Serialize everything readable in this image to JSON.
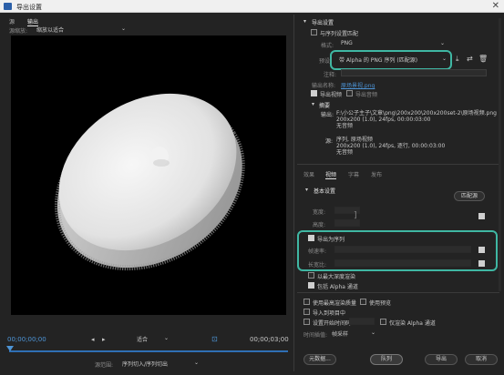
{
  "window": {
    "title": "导出设置",
    "close_glyph": "✕"
  },
  "left": {
    "tabs": [
      "源",
      "输出"
    ],
    "source_scaling_label": "源缩放:",
    "source_scaling_value": "缩放以适合",
    "timecode_start": "00;00;00;00",
    "timecode_end": "00;00;03;00",
    "fit_label": "适合",
    "source_range_label": "源范围:",
    "source_range_value": "序列切入/序列切出"
  },
  "export": {
    "section_title": "导出设置",
    "match_sequence": "与序列设置匹配",
    "format_label": "格式:",
    "format_value": "PNG",
    "preset_label": "预设:",
    "preset_value": "带 Alpha 的 PNG 序列 (匹配源)",
    "comments_label": "注释:",
    "output_name_label": "输出名称:",
    "output_name_value": "原场景视.png",
    "export_video": "导出视频",
    "export_audio": "导出音频",
    "summary_title": "摘要",
    "summary_output_label": "输出:",
    "summary_output_lines": [
      "F:\\小公子主子\\文章\\png\\200x200\\200x200set-2\\原场视频.png",
      "200x200 (1.0), 24fps, 00:00:03:00",
      "无音频"
    ],
    "summary_source_label": "源:",
    "summary_source_lines": [
      "序列, 原场视频",
      "200x200 (1.0), 24fps, 逐行, 00:00:03:00",
      "无音频"
    ]
  },
  "tabs2": [
    "效果",
    "视频",
    "字幕",
    "发布"
  ],
  "basic": {
    "title": "基本设置",
    "match_source_btn": "匹配源",
    "width_label": "宽度:",
    "height_label": "高度:",
    "export_as_sequence": "导出为序列",
    "frame_rate_label": "帧速率:",
    "aspect_label": "长宽比:",
    "render_max_depth": "以最大深度渲染",
    "include_alpha": "包括 Alpha 通道"
  },
  "bottom": {
    "max_render_quality": "使用最高渲染质量",
    "use_previews": "使用预览",
    "import_project": "导入到项目中",
    "set_start_timecode": "设置开始时间码",
    "render_alpha_only": "仅渲染 Alpha 通道",
    "interpolation_label": "时间插值:",
    "interpolation_value": "帧采样"
  },
  "buttons": {
    "metadata": "元数据...",
    "queue": "队列",
    "export": "导出",
    "cancel": "取消"
  },
  "colors": {
    "accent_outline": "#3fb7a3",
    "link": "#4d94d6"
  },
  "icons": [
    "save-preset-icon",
    "import-preset-icon",
    "delete-preset-icon",
    "in-point-icon",
    "out-point-icon",
    "crop-icon"
  ]
}
